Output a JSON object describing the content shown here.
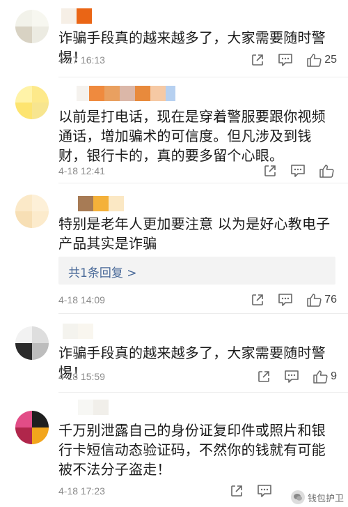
{
  "comments": [
    {
      "text": "诈骗手段真的越来越多了，大家需要随时警惕！",
      "time": "4-17 16:13",
      "likes": "25"
    },
    {
      "text": "以前是打电话，现在是穿着警服要跟你视频通话，增加骗术的可信度。但凡涉及到钱财，银行卡的，真的要多留个心眼。",
      "time": "4-18 12:41",
      "likes": ""
    },
    {
      "text": "特别是老年人更加要注意 以为是好心教电子产品其实是诈骗",
      "reply_summary": "共1条回复 >",
      "time": "4-18 14:09",
      "likes": "76"
    },
    {
      "text": "诈骗手段真的越来越多了，大家需要随时警惕！",
      "time": "4-18 15:59",
      "likes": "9"
    },
    {
      "text": "千万别泄露自己的身份证复印件或照片和银行卡短信动态验证码，不然你的钱就有可能被不法分子盗走！",
      "time": "4-18 17:23",
      "likes": ""
    }
  ],
  "icons": {
    "share": "share-icon",
    "comment": "comment-icon",
    "like": "thumb-up-icon"
  },
  "watermark": "钱包护卫",
  "colors": {
    "text": "#1b1b1b",
    "meta": "#8a8a8a",
    "link": "#4a6a99",
    "reply_bg": "#f3f3f3"
  }
}
